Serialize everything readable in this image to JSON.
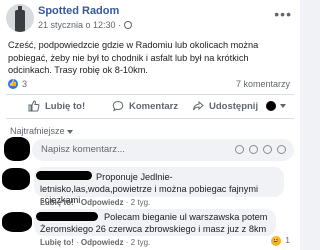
{
  "post": {
    "page_name": "Spotted Radom",
    "time": "21 stycznia o 12:30 ·",
    "text": "Cześć, podpowiedzcie gdzie w Radomiu lub okolicach można pobiegać, żeby nie był to chodnik i asfalt lub był na krótkich odcinkach. Trasy robię ok 8-10km.",
    "reaction_count": "3",
    "comment_count": "7 komentarzy"
  },
  "actions": {
    "like": "Lubię to!",
    "comment": "Komentarz",
    "share": "Udostępnij"
  },
  "comments_section": {
    "sort_label": "Najtrafniejsze",
    "input_placeholder": "Napisz komentarz..."
  },
  "comments": [
    {
      "text": "Proponuje Jedlnie-letnisko,las,woda,powietrze i można pobiegac fajnymi sciezkami",
      "like": "Lubię to!",
      "reply": "Odpowiedz",
      "age": "2 tyg."
    },
    {
      "text": "Polecam bieganie ul warszawska potem Żeromskiego 26 czerwca zbrowskiego i masz juz z 8km",
      "like": "Lubię to!",
      "reply": "Odpowiedz",
      "age": "2 tyg.",
      "reaction_count": "1"
    }
  ],
  "colors": {
    "link_blue": "#385898",
    "like_blue": "#1877f2",
    "secondary_text": "#606770"
  }
}
